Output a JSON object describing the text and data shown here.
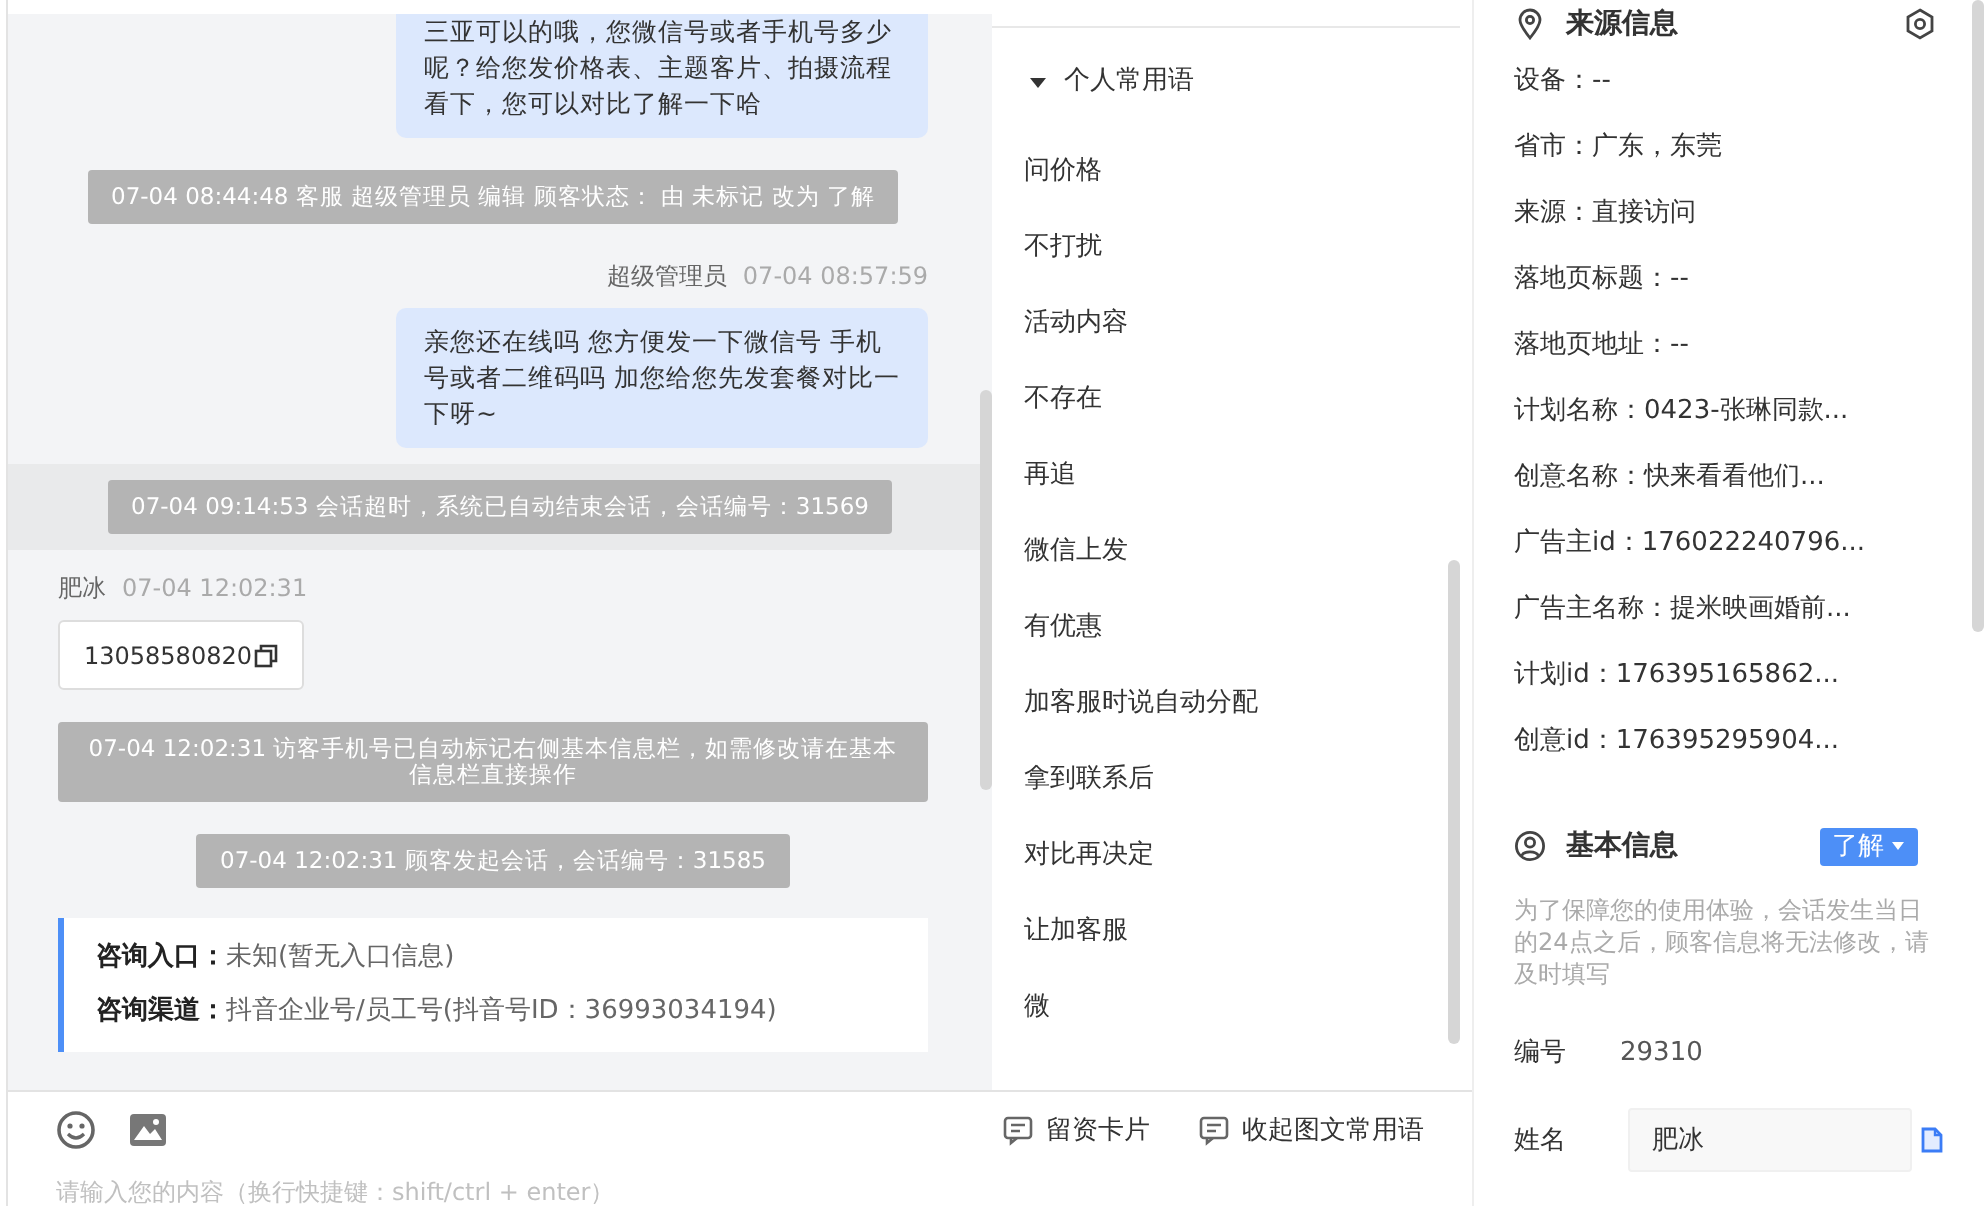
{
  "chat": {
    "messages": [
      {
        "kind": "outgoing",
        "text": "三亚可以的哦，您微信号或者手机号多少呢？给您发价格表、主题客片、拍摄流程看下，您可以对比了解一下哈"
      },
      {
        "kind": "system",
        "text": "07-04 08:44:48 客服 超级管理员 编辑 顾客状态： 由 未标记 改为 了解"
      },
      {
        "kind": "outgoing_sender",
        "name": "超级管理员",
        "time": "07-04 08:57:59"
      },
      {
        "kind": "outgoing",
        "text": "亲您还在线吗 您方便发一下微信号 手机号或者二维码吗 加您给您先发套餐对比一下呀~"
      },
      {
        "kind": "system",
        "text": "07-04 09:14:53 会话超时，系统已自动结束会话，会话编号：31569",
        "highlighted": true
      },
      {
        "kind": "incoming_sender",
        "name": "肥冰",
        "time": "07-04 12:02:31"
      },
      {
        "kind": "phone",
        "text": "13058580820"
      },
      {
        "kind": "system",
        "text": "07-04 12:02:31 访客手机号已自动标记右侧基本信息栏，如需修改请在基本信息栏直接操作"
      },
      {
        "kind": "system",
        "text": "07-04 12:02:31 顾客发起会话，会话编号：31585"
      },
      {
        "kind": "entry",
        "rows": [
          "**咨询入口：**未知(暂无入口信息)",
          "**咨询渠道：**抖音企业号/员工号(抖音号ID：36993034194)"
        ]
      }
    ]
  },
  "phrases": {
    "group": {
      "title": "个人常用语",
      "expanded": true
    },
    "items": [
      "问价格",
      "不打扰",
      "活动内容",
      "不存在",
      "再追",
      "微信上发",
      "有优惠",
      "加客服时说自动分配",
      "拿到联系后",
      "对比再决定",
      "让加客服",
      "微"
    ]
  },
  "composer": {
    "actions": [
      "留资卡片",
      "收起图文常用语"
    ],
    "placeholder": "请输入您的内容（换行快捷键：shift/ctrl + enter）"
  },
  "source": {
    "title": "来源信息",
    "rows": [
      "设备：--",
      "省市：广东，东莞",
      "来源：直接访问",
      "落地页标题：--",
      "落地页地址：--",
      "计划名称：0423-张琳同款...",
      "创意名称：快来看看他们...",
      "广告主id：176022240796...",
      "广告主名称：提米映画婚前...",
      "计划id：176395165862...",
      "创意id：176395295904..."
    ]
  },
  "basic": {
    "title": "基本信息",
    "status": "了解",
    "note": "为了保障您的使用体验，会话发生当日的24点之后，顾客信息将无法修改，请及时填写",
    "fields": [
      {
        "kind": "text",
        "label": "编号",
        "value": "29310"
      },
      {
        "kind": "input",
        "label": "姓名",
        "value": "肥冰"
      }
    ]
  }
}
